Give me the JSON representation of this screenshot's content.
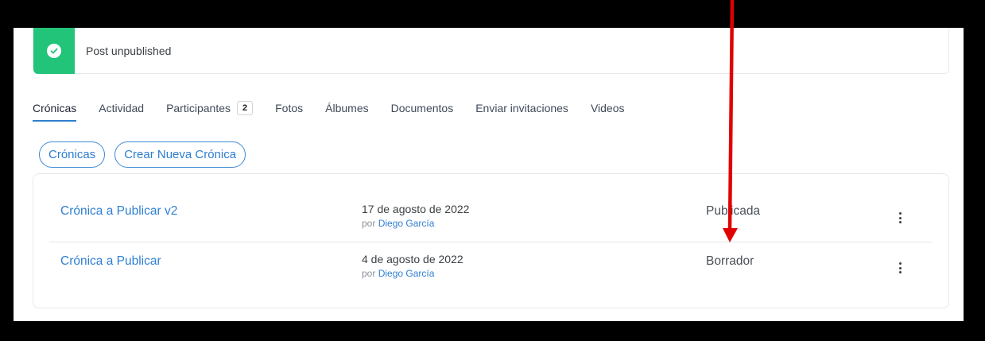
{
  "notice": {
    "message": "Post unpublished",
    "icon": "check-circle-icon",
    "color": "#22c47a"
  },
  "tabs": [
    {
      "label": "Crónicas",
      "active": true
    },
    {
      "label": "Actividad"
    },
    {
      "label": "Participantes",
      "badge": "2"
    },
    {
      "label": "Fotos"
    },
    {
      "label": "Álbumes"
    },
    {
      "label": "Documentos"
    },
    {
      "label": "Enviar invitaciones"
    },
    {
      "label": "Videos"
    }
  ],
  "actions": {
    "cronicas_label": "Crónicas",
    "create_label": "Crear Nueva Crónica"
  },
  "posts": [
    {
      "title": "Crónica a Publicar v2",
      "date": "17 de agosto de 2022",
      "by_prefix": "por",
      "author": "Diego García",
      "status": "Publicada"
    },
    {
      "title": "Crónica a Publicar",
      "date": "4 de agosto de 2022",
      "by_prefix": "por",
      "author": "Diego García",
      "status": "Borrador"
    }
  ],
  "colors": {
    "accent": "#2f7fd3",
    "success": "#22c47a",
    "annotation_arrow": "#e00000"
  }
}
